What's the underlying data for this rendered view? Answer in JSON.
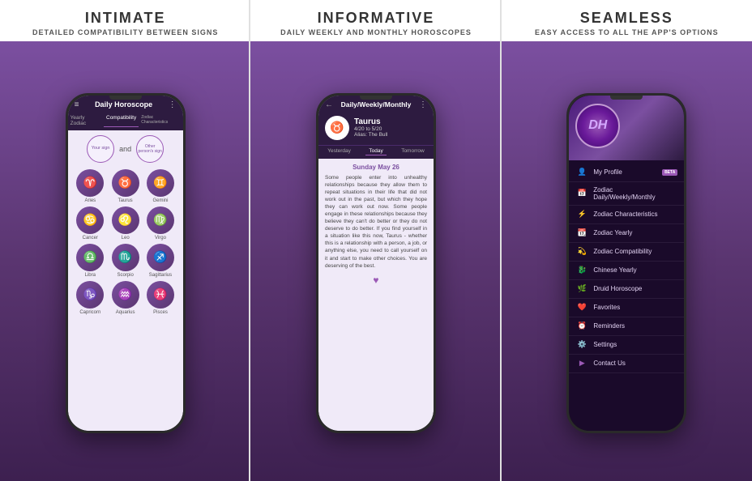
{
  "panels": [
    {
      "id": "intimate",
      "title": "INTIMATE",
      "subtitle": "DETAILED COMPATIBILITY BETWEEN SIGNS",
      "phone": {
        "appTitle": "Daily Horoscope",
        "tabs": [
          "Yearly Zodiac",
          "Compatibility",
          "Zodiac Characteristics"
        ],
        "activeTab": "Compatibility",
        "selectors": {
          "sign1": "Your sign",
          "sign2": "Other person's sign",
          "separator": "and"
        },
        "zodiacSigns": [
          {
            "name": "Aries",
            "symbol": "♈"
          },
          {
            "name": "Taurus",
            "symbol": "♉"
          },
          {
            "name": "Gemini",
            "symbol": "♊"
          },
          {
            "name": "Cancer",
            "symbol": "♋"
          },
          {
            "name": "Leo",
            "symbol": "♌"
          },
          {
            "name": "Virgo",
            "symbol": "♍"
          },
          {
            "name": "Libra",
            "symbol": "♎"
          },
          {
            "name": "Scorpio",
            "symbol": "♏"
          },
          {
            "name": "Sagittarius",
            "symbol": "♐"
          },
          {
            "name": "Capricorn",
            "symbol": "♑"
          },
          {
            "name": "Aquarius",
            "symbol": "♒"
          },
          {
            "name": "Pisces",
            "symbol": "♓"
          }
        ]
      }
    },
    {
      "id": "informative",
      "title": "INFORMATIVE",
      "subtitle": "DAILY WEEKLY AND MONTHLY HOROSCOPES",
      "phone": {
        "appTitle": "Daily/Weekly/Monthly",
        "sign": {
          "name": "Taurus",
          "dates": "4/20 to 5/20",
          "alias": "Alias: The Bull",
          "symbol": "♉"
        },
        "dateTabs": [
          "Yesterday",
          "Today",
          "Tomorrow"
        ],
        "activeDateTab": "Today",
        "dateTitle": "Sunday May 26",
        "horoscopeText": "Some people enter into unhealthy relationships because they allow them to repeat situations in their life that did not work out in the past, but which they hope they can work out now. Some people engage in these relationships because they believe they can't do better or they do not deserve to do better. If you find yourself in a situation like this now, Taurus - whether this is a relationship with a person, a job, or anything else, you need to call yourself on it and start to make other choices. You are deserving of the best."
      }
    },
    {
      "id": "seamless",
      "title": "SEAMLESS",
      "subtitle": "EASY ACCESS TO ALL THE APP'S OPTIONS",
      "phone": {
        "logoText": "DH",
        "menuItems": [
          {
            "icon": "👤",
            "label": "My Profile",
            "badge": "BETA"
          },
          {
            "icon": "📅",
            "label": "Zodiac Daily/Weekly/Monthly",
            "badge": null
          },
          {
            "icon": "⚡",
            "label": "Zodiac Characteristics",
            "badge": null
          },
          {
            "icon": "📆",
            "label": "Zodiac Yearly",
            "badge": null
          },
          {
            "icon": "💫",
            "label": "Zodiac Compatibility",
            "badge": null
          },
          {
            "icon": "🐉",
            "label": "Chinese Yearly",
            "badge": null
          },
          {
            "icon": "🌿",
            "label": "Druid Horoscope",
            "badge": null
          },
          {
            "icon": "❤️",
            "label": "Favorites",
            "badge": null
          },
          {
            "icon": "⏰",
            "label": "Reminders",
            "badge": null
          },
          {
            "icon": "⚙️",
            "label": "Settings",
            "badge": null
          },
          {
            "icon": "▶",
            "label": "Contact Us",
            "badge": null
          }
        ]
      }
    }
  ]
}
